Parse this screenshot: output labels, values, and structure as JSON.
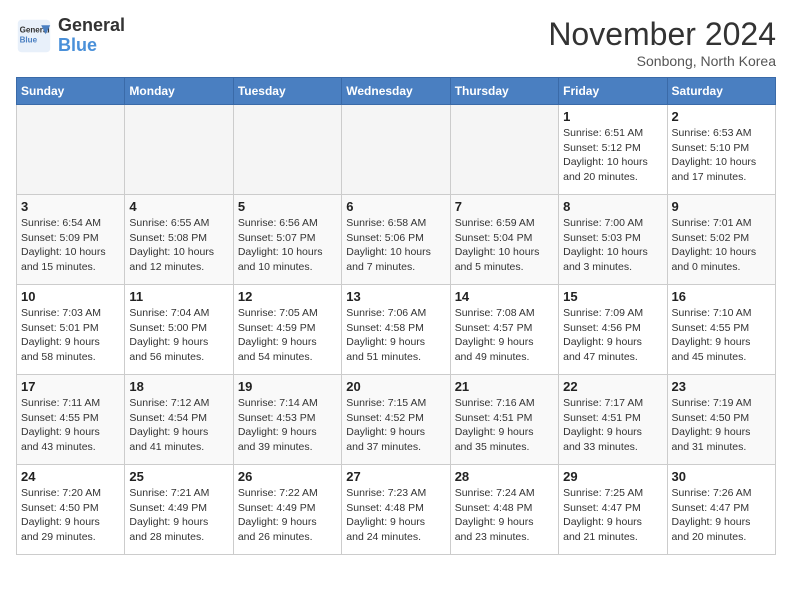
{
  "header": {
    "logo_line1": "General",
    "logo_line2": "Blue",
    "month_title": "November 2024",
    "subtitle": "Sonbong, North Korea"
  },
  "weekdays": [
    "Sunday",
    "Monday",
    "Tuesday",
    "Wednesday",
    "Thursday",
    "Friday",
    "Saturday"
  ],
  "weeks": [
    [
      {
        "day": "",
        "info": ""
      },
      {
        "day": "",
        "info": ""
      },
      {
        "day": "",
        "info": ""
      },
      {
        "day": "",
        "info": ""
      },
      {
        "day": "",
        "info": ""
      },
      {
        "day": "1",
        "info": "Sunrise: 6:51 AM\nSunset: 5:12 PM\nDaylight: 10 hours\nand 20 minutes."
      },
      {
        "day": "2",
        "info": "Sunrise: 6:53 AM\nSunset: 5:10 PM\nDaylight: 10 hours\nand 17 minutes."
      }
    ],
    [
      {
        "day": "3",
        "info": "Sunrise: 6:54 AM\nSunset: 5:09 PM\nDaylight: 10 hours\nand 15 minutes."
      },
      {
        "day": "4",
        "info": "Sunrise: 6:55 AM\nSunset: 5:08 PM\nDaylight: 10 hours\nand 12 minutes."
      },
      {
        "day": "5",
        "info": "Sunrise: 6:56 AM\nSunset: 5:07 PM\nDaylight: 10 hours\nand 10 minutes."
      },
      {
        "day": "6",
        "info": "Sunrise: 6:58 AM\nSunset: 5:06 PM\nDaylight: 10 hours\nand 7 minutes."
      },
      {
        "day": "7",
        "info": "Sunrise: 6:59 AM\nSunset: 5:04 PM\nDaylight: 10 hours\nand 5 minutes."
      },
      {
        "day": "8",
        "info": "Sunrise: 7:00 AM\nSunset: 5:03 PM\nDaylight: 10 hours\nand 3 minutes."
      },
      {
        "day": "9",
        "info": "Sunrise: 7:01 AM\nSunset: 5:02 PM\nDaylight: 10 hours\nand 0 minutes."
      }
    ],
    [
      {
        "day": "10",
        "info": "Sunrise: 7:03 AM\nSunset: 5:01 PM\nDaylight: 9 hours\nand 58 minutes."
      },
      {
        "day": "11",
        "info": "Sunrise: 7:04 AM\nSunset: 5:00 PM\nDaylight: 9 hours\nand 56 minutes."
      },
      {
        "day": "12",
        "info": "Sunrise: 7:05 AM\nSunset: 4:59 PM\nDaylight: 9 hours\nand 54 minutes."
      },
      {
        "day": "13",
        "info": "Sunrise: 7:06 AM\nSunset: 4:58 PM\nDaylight: 9 hours\nand 51 minutes."
      },
      {
        "day": "14",
        "info": "Sunrise: 7:08 AM\nSunset: 4:57 PM\nDaylight: 9 hours\nand 49 minutes."
      },
      {
        "day": "15",
        "info": "Sunrise: 7:09 AM\nSunset: 4:56 PM\nDaylight: 9 hours\nand 47 minutes."
      },
      {
        "day": "16",
        "info": "Sunrise: 7:10 AM\nSunset: 4:55 PM\nDaylight: 9 hours\nand 45 minutes."
      }
    ],
    [
      {
        "day": "17",
        "info": "Sunrise: 7:11 AM\nSunset: 4:55 PM\nDaylight: 9 hours\nand 43 minutes."
      },
      {
        "day": "18",
        "info": "Sunrise: 7:12 AM\nSunset: 4:54 PM\nDaylight: 9 hours\nand 41 minutes."
      },
      {
        "day": "19",
        "info": "Sunrise: 7:14 AM\nSunset: 4:53 PM\nDaylight: 9 hours\nand 39 minutes."
      },
      {
        "day": "20",
        "info": "Sunrise: 7:15 AM\nSunset: 4:52 PM\nDaylight: 9 hours\nand 37 minutes."
      },
      {
        "day": "21",
        "info": "Sunrise: 7:16 AM\nSunset: 4:51 PM\nDaylight: 9 hours\nand 35 minutes."
      },
      {
        "day": "22",
        "info": "Sunrise: 7:17 AM\nSunset: 4:51 PM\nDaylight: 9 hours\nand 33 minutes."
      },
      {
        "day": "23",
        "info": "Sunrise: 7:19 AM\nSunset: 4:50 PM\nDaylight: 9 hours\nand 31 minutes."
      }
    ],
    [
      {
        "day": "24",
        "info": "Sunrise: 7:20 AM\nSunset: 4:50 PM\nDaylight: 9 hours\nand 29 minutes."
      },
      {
        "day": "25",
        "info": "Sunrise: 7:21 AM\nSunset: 4:49 PM\nDaylight: 9 hours\nand 28 minutes."
      },
      {
        "day": "26",
        "info": "Sunrise: 7:22 AM\nSunset: 4:49 PM\nDaylight: 9 hours\nand 26 minutes."
      },
      {
        "day": "27",
        "info": "Sunrise: 7:23 AM\nSunset: 4:48 PM\nDaylight: 9 hours\nand 24 minutes."
      },
      {
        "day": "28",
        "info": "Sunrise: 7:24 AM\nSunset: 4:48 PM\nDaylight: 9 hours\nand 23 minutes."
      },
      {
        "day": "29",
        "info": "Sunrise: 7:25 AM\nSunset: 4:47 PM\nDaylight: 9 hours\nand 21 minutes."
      },
      {
        "day": "30",
        "info": "Sunrise: 7:26 AM\nSunset: 4:47 PM\nDaylight: 9 hours\nand 20 minutes."
      }
    ]
  ]
}
